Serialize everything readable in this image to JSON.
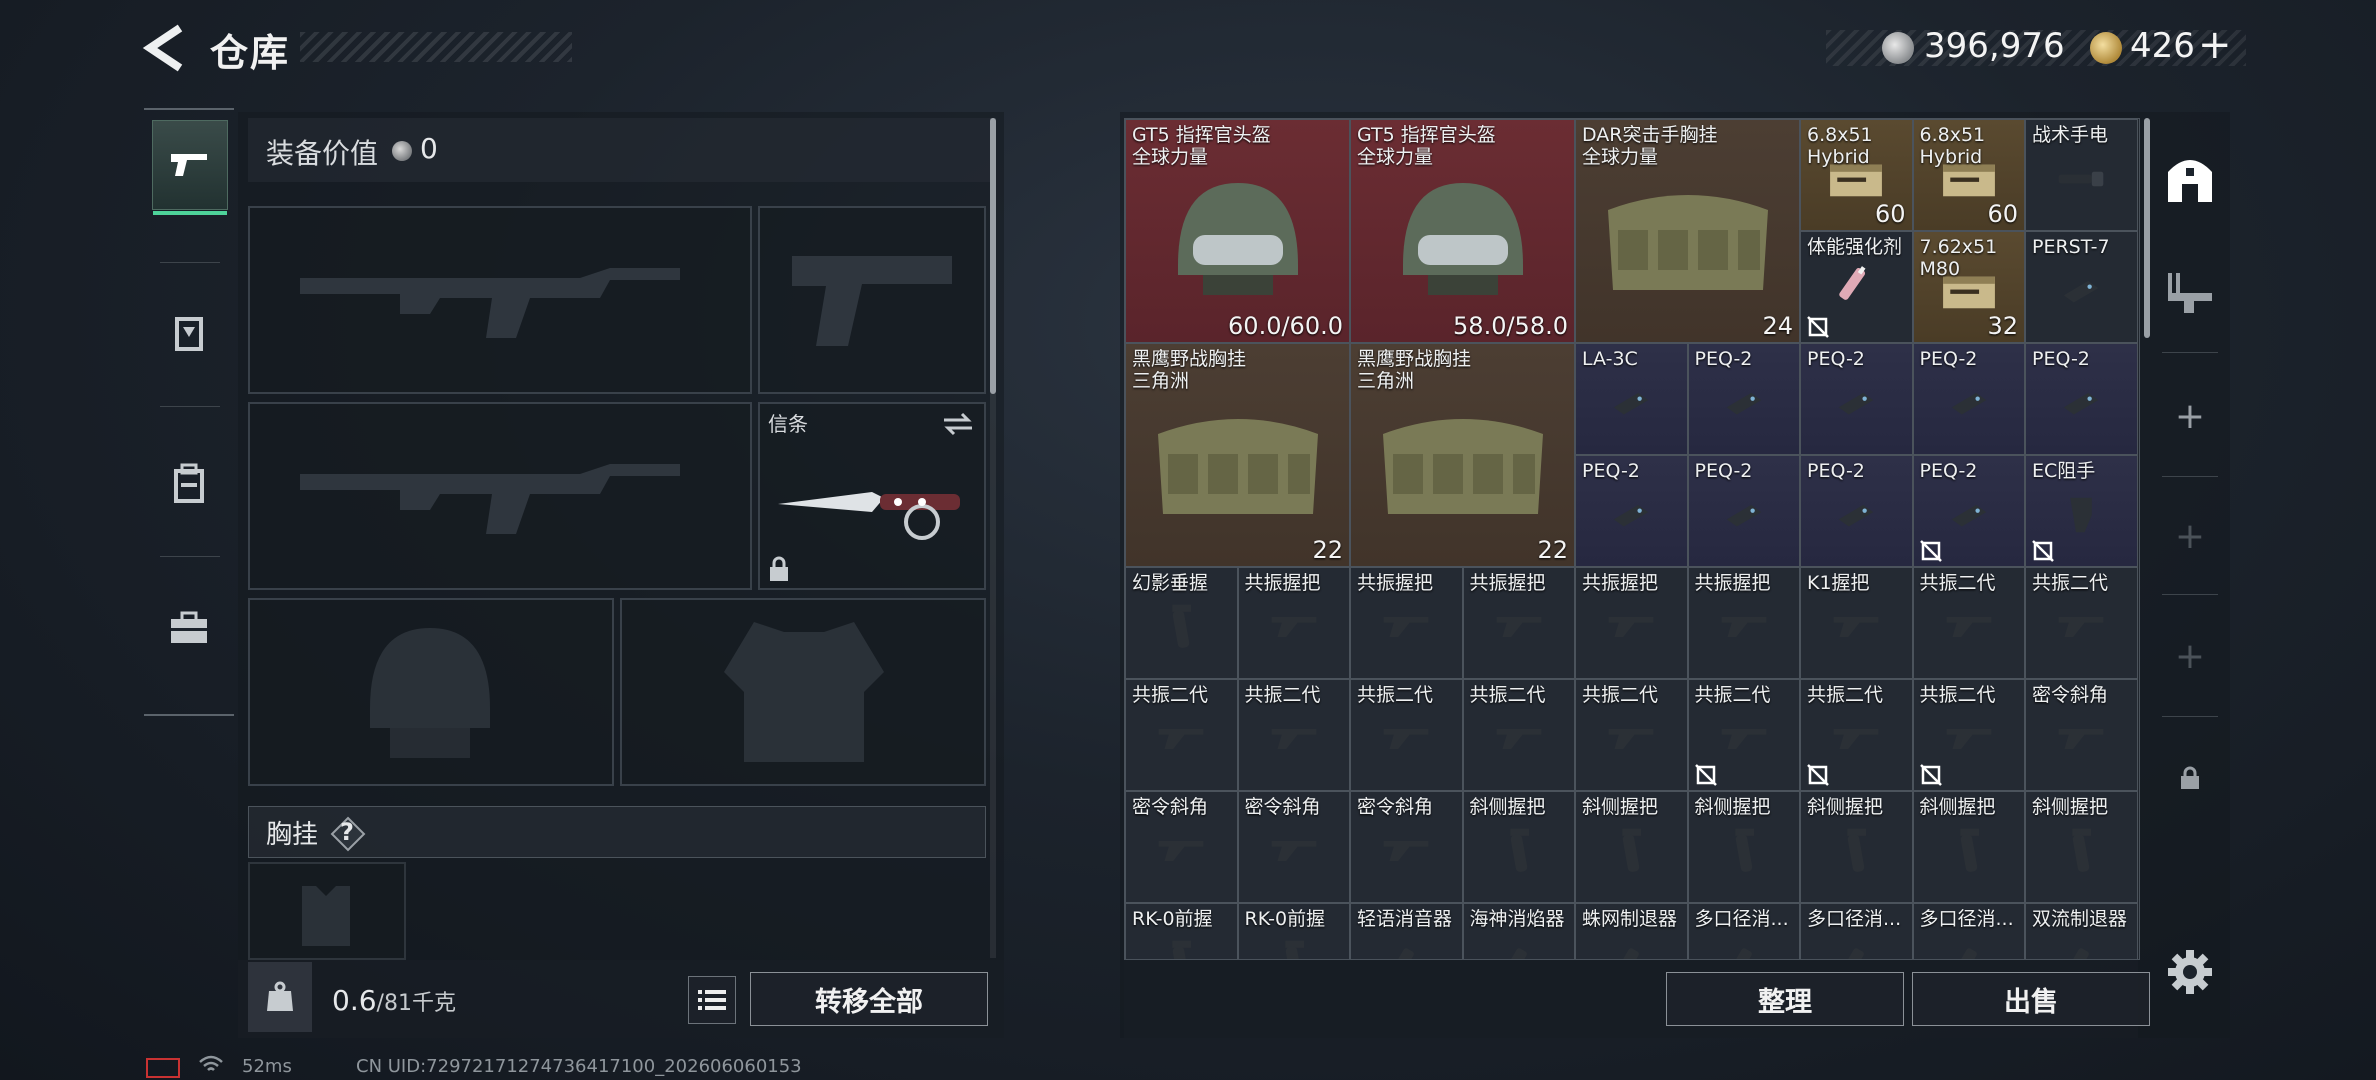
{
  "header": {
    "title": "仓库"
  },
  "currency": {
    "silver": "396,976",
    "gold": "426",
    "gold_plus": "+"
  },
  "left_panel": {
    "equip_value_label": "装备价值",
    "equip_value": "0",
    "melee_slot_title": "信条",
    "chest_section_label": "胸挂",
    "chest_help": "?",
    "weight_current": "0.6",
    "weight_max": "/81千克",
    "transfer_all_label": "转移全部"
  },
  "stash": {
    "items": [
      {
        "name": "GT5 指挥官头盔\n全球力量",
        "badge": "60.0/60.0",
        "bg": "red",
        "icon": "helmet-icon"
      },
      {
        "name": "GT5 指挥官头盔\n全球力量",
        "badge": "58.0/58.0",
        "bg": "red",
        "icon": "helmet-icon"
      },
      {
        "name": "DAR突击手胸挂\n全球力量",
        "badge": "24",
        "bg": "brown",
        "icon": "chest-rig-icon"
      },
      {
        "name": "6.8x51\nHybrid",
        "badge": "60",
        "bg": "gold",
        "icon": "ammo-box-icon"
      },
      {
        "name": "6.8x51\nHybrid",
        "badge": "60",
        "bg": "gold",
        "icon": "ammo-box-icon"
      },
      {
        "name": "战术手电",
        "badge": "",
        "bg": "dark",
        "icon": "flashlight-icon"
      },
      {
        "name": "体能强化剂",
        "badge": "",
        "bg": "dark",
        "icon": "syringe-icon"
      },
      {
        "name": "7.62x51\nM80",
        "badge": "32",
        "bg": "gold",
        "icon": "ammo-box-icon"
      },
      {
        "name": "PERST-7",
        "badge": "",
        "bg": "dark",
        "icon": "laser-module-icon"
      },
      {
        "name": "黑鹰野战胸挂\n三角洲",
        "badge": "22",
        "bg": "brown",
        "icon": "chest-rig-icon"
      },
      {
        "name": "黑鹰野战胸挂\n三角洲",
        "badge": "22",
        "bg": "brown",
        "icon": "chest-rig-icon"
      },
      {
        "name": "LA-3C",
        "badge": "",
        "bg": "purple",
        "icon": "laser-module-icon"
      },
      {
        "name": "PEQ-2",
        "badge": "",
        "bg": "purple",
        "icon": "laser-module-icon"
      },
      {
        "name": "PEQ-2",
        "badge": "",
        "bg": "purple",
        "icon": "laser-module-icon"
      },
      {
        "name": "PEQ-2",
        "badge": "",
        "bg": "purple",
        "icon": "laser-module-icon"
      },
      {
        "name": "PEQ-2",
        "badge": "",
        "bg": "purple",
        "icon": "laser-module-icon"
      },
      {
        "name": "PEQ-2",
        "badge": "",
        "bg": "purple",
        "icon": "laser-module-icon"
      },
      {
        "name": "PEQ-2",
        "badge": "",
        "bg": "purple",
        "icon": "laser-module-icon"
      },
      {
        "name": "PEQ-2",
        "badge": "",
        "bg": "purple",
        "icon": "laser-module-icon"
      },
      {
        "name": "PEQ-2",
        "badge": "",
        "bg": "purple",
        "icon": "laser-module-icon"
      },
      {
        "name": "EC阻手",
        "badge": "",
        "bg": "purple",
        "icon": "handstop-icon"
      },
      {
        "name": "幻影垂握",
        "badge": "",
        "bg": "dark",
        "icon": "vertical-grip-icon"
      },
      {
        "name": "共振握把",
        "badge": "",
        "bg": "dark",
        "icon": "angled-grip-icon"
      },
      {
        "name": "共振握把",
        "badge": "",
        "bg": "dark",
        "icon": "angled-grip-icon"
      },
      {
        "name": "共振握把",
        "badge": "",
        "bg": "dark",
        "icon": "angled-grip-icon"
      },
      {
        "name": "共振握把",
        "badge": "",
        "bg": "dark",
        "icon": "angled-grip-icon"
      },
      {
        "name": "共振握把",
        "badge": "",
        "bg": "dark",
        "icon": "angled-grip-icon"
      },
      {
        "name": "K1握把",
        "badge": "",
        "bg": "dark",
        "icon": "angled-grip-icon"
      },
      {
        "name": "共振二代",
        "badge": "",
        "bg": "dark",
        "icon": "angled-grip-icon"
      },
      {
        "name": "共振二代",
        "badge": "",
        "bg": "dark",
        "icon": "angled-grip-icon"
      },
      {
        "name": "共振二代",
        "badge": "",
        "bg": "dark",
        "icon": "angled-grip-icon"
      },
      {
        "name": "共振二代",
        "badge": "",
        "bg": "dark",
        "icon": "angled-grip-icon"
      },
      {
        "name": "共振二代",
        "badge": "",
        "bg": "dark",
        "icon": "angled-grip-icon"
      },
      {
        "name": "共振二代",
        "badge": "",
        "bg": "dark",
        "icon": "angled-grip-icon"
      },
      {
        "name": "共振二代",
        "badge": "",
        "bg": "dark",
        "icon": "angled-grip-icon"
      },
      {
        "name": "共振二代",
        "badge": "",
        "bg": "dark",
        "icon": "angled-grip-icon"
      },
      {
        "name": "共振二代",
        "badge": "",
        "bg": "dark",
        "icon": "angled-grip-icon"
      },
      {
        "name": "共振二代",
        "badge": "",
        "bg": "dark",
        "icon": "angled-grip-icon"
      },
      {
        "name": "密令斜角",
        "badge": "",
        "bg": "dark",
        "icon": "angled-grip-icon"
      },
      {
        "name": "密令斜角",
        "badge": "",
        "bg": "dark",
        "icon": "angled-grip-icon"
      },
      {
        "name": "密令斜角",
        "badge": "",
        "bg": "dark",
        "icon": "angled-grip-icon"
      },
      {
        "name": "密令斜角",
        "badge": "",
        "bg": "dark",
        "icon": "angled-grip-icon"
      },
      {
        "name": "斜侧握把",
        "badge": "",
        "bg": "dark",
        "icon": "vertical-grip-icon"
      },
      {
        "name": "斜侧握把",
        "badge": "",
        "bg": "dark",
        "icon": "vertical-grip-icon"
      },
      {
        "name": "斜侧握把",
        "badge": "",
        "bg": "dark",
        "icon": "vertical-grip-icon"
      },
      {
        "name": "斜侧握把",
        "badge": "",
        "bg": "dark",
        "icon": "vertical-grip-icon"
      },
      {
        "name": "斜侧握把",
        "badge": "",
        "bg": "dark",
        "icon": "vertical-grip-icon"
      },
      {
        "name": "斜侧握把",
        "badge": "",
        "bg": "dark",
        "icon": "vertical-grip-icon"
      },
      {
        "name": "RK-0前握",
        "badge": "",
        "bg": "dark",
        "icon": "vertical-grip-icon"
      },
      {
        "name": "RK-0前握",
        "badge": "",
        "bg": "dark",
        "icon": "vertical-grip-icon"
      },
      {
        "name": "轻语消音器",
        "badge": "",
        "bg": "dark",
        "icon": "suppressor-icon"
      },
      {
        "name": "海神消焰器",
        "badge": "",
        "bg": "dark",
        "icon": "suppressor-icon"
      },
      {
        "name": "蛛网制退器",
        "badge": "",
        "bg": "dark",
        "icon": "suppressor-icon"
      },
      {
        "name": "多口径消...",
        "badge": "",
        "bg": "dark",
        "icon": "suppressor-icon"
      },
      {
        "name": "多口径消...",
        "badge": "",
        "bg": "dark",
        "icon": "suppressor-icon"
      },
      {
        "name": "多口径消...",
        "badge": "",
        "bg": "dark",
        "icon": "suppressor-icon"
      },
      {
        "name": "双流制退器",
        "badge": "",
        "bg": "dark",
        "icon": "suppressor-icon"
      }
    ],
    "sort_label": "整理",
    "sell_label": "出售"
  },
  "status_bar": {
    "ping": "52ms",
    "uid": "CN UID:72972171274736417100_202606060153"
  },
  "colors": {
    "accent_green": "#4ed39a",
    "red_rarity": "#6b2d33",
    "gold_rarity": "#5a4a30",
    "purple_rarity": "#2e3048"
  }
}
